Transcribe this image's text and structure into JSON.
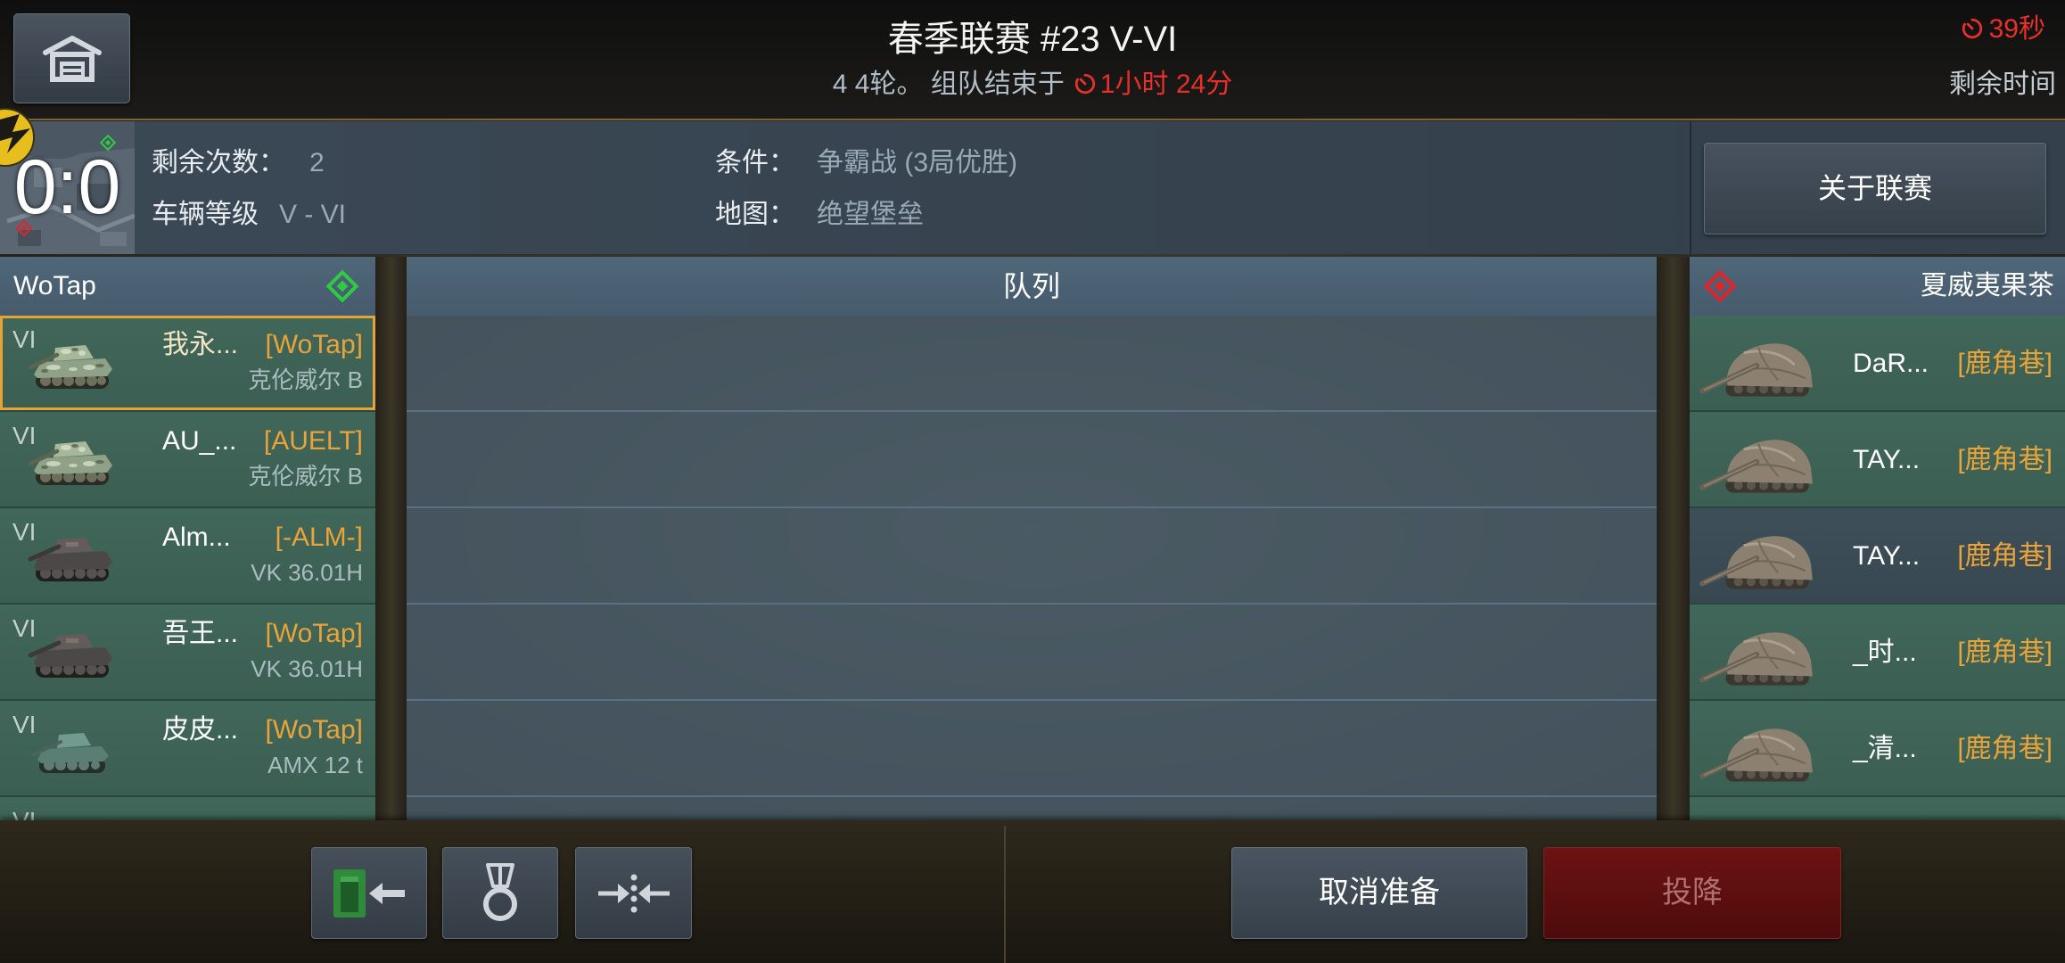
{
  "header": {
    "home_icon": "garage-icon",
    "title": "春季联赛 #23 V-VI",
    "subtitle_prefix": "4 4轮。 组队结束于",
    "subtitle_time": "1小时 24分",
    "timer_icon": "stopwatch-icon",
    "timer": "39秒",
    "timer_label": "剩余时间"
  },
  "info": {
    "score": "0:0",
    "attempts_label": "剩余次数：",
    "attempts_value": "2",
    "tier_label": "车辆等级",
    "tier_value": "V - VI",
    "condition_label": "条件：",
    "condition_value": "争霸战 (3局优胜)",
    "map_label": "地图：",
    "map_value": "绝望堡垒",
    "about_button": "关于联赛"
  },
  "left_team": {
    "name": "WoTap",
    "marker_icon": "green-diamond-icon",
    "players": [
      {
        "tier": "VI",
        "name": "我永...",
        "clan": "[WoTap]",
        "vehicle": "克伦威尔 B",
        "tank_icon": "cromwell-tank-icon",
        "selected": true
      },
      {
        "tier": "VI",
        "name": "AU_...",
        "clan": "[AUELT]",
        "vehicle": "克伦威尔 B",
        "tank_icon": "cromwell-tank-icon"
      },
      {
        "tier": "VI",
        "name": "Alm...",
        "clan": "[-ALM-]",
        "vehicle": "VK 36.01H",
        "tank_icon": "vk-tank-icon"
      },
      {
        "tier": "VI",
        "name": "吾王...",
        "clan": "[WoTap]",
        "vehicle": "VK 36.01H",
        "tank_icon": "vk-tank-icon"
      },
      {
        "tier": "VI",
        "name": "皮皮...",
        "clan": "[WoTap]",
        "vehicle": "AMX 12 t",
        "tank_icon": "amx-tank-icon"
      },
      {
        "tier": "VI",
        "tank_icon": "tank-icon"
      }
    ]
  },
  "queue": {
    "title": "队列"
  },
  "right_team": {
    "name": "夏威夷果茶",
    "marker_icon": "red-diamond-icon",
    "players": [
      {
        "name": "DaR...",
        "clan": "[鹿角巷]",
        "tank_icon": "tank-destroyer-icon"
      },
      {
        "name": "TAY...",
        "clan": "[鹿角巷]",
        "tank_icon": "tank-destroyer-icon"
      },
      {
        "name": "TAY...",
        "clan": "[鹿角巷]",
        "tank_icon": "tank-destroyer-icon"
      },
      {
        "name": "_时...",
        "clan": "[鹿角巷]",
        "tank_icon": "tank-destroyer-icon"
      },
      {
        "name": "_清...",
        "clan": "[鹿角巷]",
        "tank_icon": "tank-destroyer-icon"
      },
      {
        "tank_icon": "tank-destroyer-icon"
      }
    ]
  },
  "footer": {
    "exit_icon": "exit-platoon-icon",
    "medal_icon": "medal-icon",
    "merge_icon": "merge-arrows-icon",
    "cancel_ready": "取消准备",
    "surrender": "投降"
  },
  "colors": {
    "accent_orange": "#e8a33a",
    "timer_red": "#e8302a",
    "ally_green": "#2ecc40",
    "enemy_red": "#e0242a",
    "row_green": "#3e6355",
    "surrender_red": "#5e1010"
  }
}
